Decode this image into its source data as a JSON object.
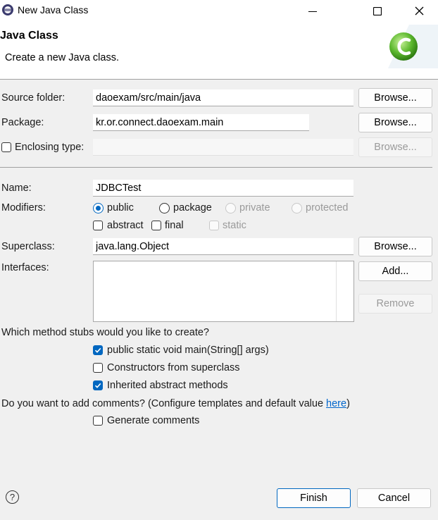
{
  "window": {
    "title": "New Java Class"
  },
  "header": {
    "title": "Java Class",
    "message": "Create a new Java class."
  },
  "source_folder": {
    "label": "Source folder:",
    "value": "daoexam/src/main/java",
    "browse": "Browse..."
  },
  "package": {
    "label": "Package:",
    "value": "kr.or.connect.daoexam.main",
    "browse": "Browse..."
  },
  "enclosing": {
    "label": "Enclosing type:",
    "value": "",
    "browse": "Browse..."
  },
  "name": {
    "label": "Name:",
    "value": "JDBCTest"
  },
  "modifiers": {
    "label": "Modifiers:",
    "public": "public",
    "package": "package",
    "private": "private",
    "protected": "protected",
    "abstract": "abstract",
    "final": "final",
    "static": "static"
  },
  "superclass": {
    "label": "Superclass:",
    "value": "java.lang.Object",
    "browse": "Browse..."
  },
  "interfaces": {
    "label": "Interfaces:",
    "add": "Add...",
    "remove": "Remove"
  },
  "stubs": {
    "question": "Which method stubs would you like to create?",
    "main": "public static void main(String[] args)",
    "constructors": "Constructors from superclass",
    "inherited": "Inherited abstract methods"
  },
  "comments": {
    "question": "Do you want to add comments? (Configure templates and default value ",
    "link": "here",
    "close": ")",
    "generate": "Generate comments"
  },
  "footer": {
    "finish": "Finish",
    "cancel": "Cancel",
    "help": "?"
  },
  "colors": {
    "accent": "#0067c0",
    "link": "#0066cc",
    "logo": "#5cb82e"
  }
}
